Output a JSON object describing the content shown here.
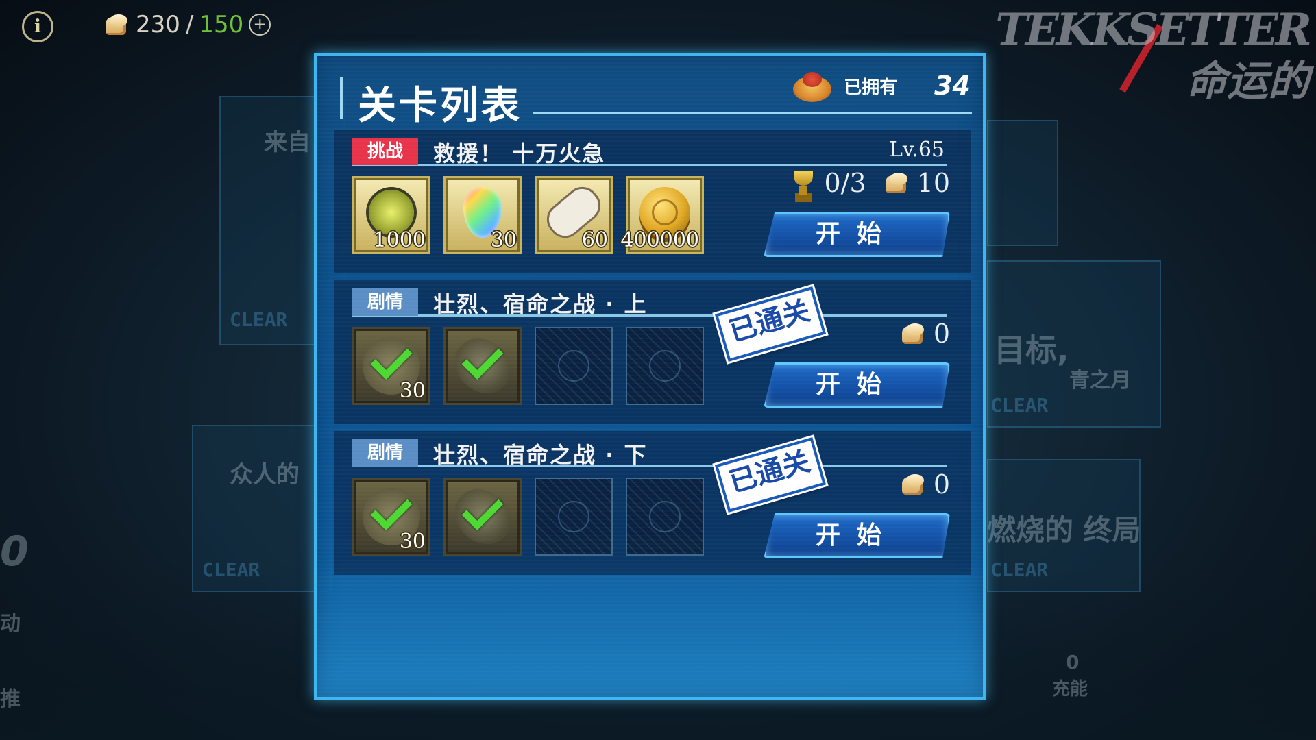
{
  "hud": {
    "stamina_current": "230",
    "stamina_separator": "/",
    "stamina_max": "150",
    "plus_symbol": "+",
    "info_symbol": "i",
    "info_icon": "info-icon",
    "stamina_icon": "bread-icon"
  },
  "background": {
    "logo_line1": "TEKKSETTER",
    "logo_line2": "命运的",
    "card_texts": [
      "来自",
      "众人的",
      "目标,",
      "青之月",
      "燃烧的 终局"
    ],
    "clear_marks": [
      "CLEAR",
      "CLEAR",
      "CLEAR",
      "CLEAR"
    ],
    "side_texts": [
      "0",
      "动",
      "推",
      "0",
      "充能"
    ]
  },
  "panel": {
    "title": "关卡列表",
    "owned_label": "已拥有",
    "owned_count": "34",
    "owned_icon": "cake-icon"
  },
  "stages": [
    {
      "tag": "挑战",
      "tag_type": "challenge",
      "name": "救援！ 十万火急",
      "level": "Lv.65",
      "trophy_progress": "0/3",
      "stamina_cost": "10",
      "cleared": false,
      "start_label": "开始",
      "rewards": [
        {
          "type": "item",
          "icon": "lantern-icon",
          "qty": "1000"
        },
        {
          "type": "item",
          "icon": "rainbow-gem-icon",
          "qty": "30"
        },
        {
          "type": "item",
          "icon": "ticket-icon",
          "qty": "60"
        },
        {
          "type": "item",
          "icon": "gold-coin-icon",
          "qty": "400000"
        }
      ]
    },
    {
      "tag": "剧情",
      "tag_type": "story",
      "name": "壮烈、宿命之战 · 上",
      "stamina_cost": "0",
      "cleared": true,
      "cleared_label": "已通关",
      "start_label": "开始",
      "rewards": [
        {
          "type": "done",
          "icon": "check-icon",
          "qty": "30"
        },
        {
          "type": "done",
          "icon": "check-icon",
          "qty": ""
        },
        {
          "type": "empty"
        },
        {
          "type": "empty"
        }
      ]
    },
    {
      "tag": "剧情",
      "tag_type": "story",
      "name": "壮烈、宿命之战 · 下",
      "stamina_cost": "0",
      "cleared": true,
      "cleared_label": "已通关",
      "start_label": "开始",
      "rewards": [
        {
          "type": "done",
          "icon": "check-icon",
          "qty": "30"
        },
        {
          "type": "done",
          "icon": "check-icon",
          "qty": ""
        },
        {
          "type": "empty"
        },
        {
          "type": "empty"
        }
      ]
    }
  ],
  "colors": {
    "panel_border": "#3fb6f0",
    "challenge_tag": "#e8344a",
    "story_tag": "#5a8ec4",
    "stamina_max": "#6fbf3a",
    "button_blue": "#1e6ac8"
  }
}
